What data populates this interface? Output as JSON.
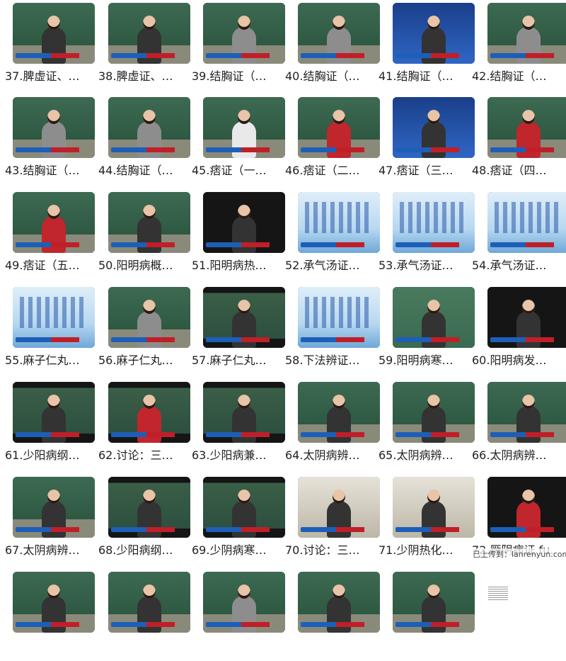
{
  "videos": [
    {
      "label": "37.脾虚证、…",
      "style": "board"
    },
    {
      "label": "38.脾虚证、…",
      "style": "board"
    },
    {
      "label": "39.结胸证（…",
      "style": "board grey"
    },
    {
      "label": "40.结胸证（…",
      "style": "board grey"
    },
    {
      "label": "41.结胸证（…",
      "style": "blue"
    },
    {
      "label": "42.结胸证（…",
      "style": "board grey"
    },
    {
      "label": "43.结胸证（…",
      "style": "board grey"
    },
    {
      "label": "44.结胸证（…",
      "style": "board grey"
    },
    {
      "label": "45.痞证（一…",
      "style": "board white"
    },
    {
      "label": "46.痞证（二…",
      "style": "board red"
    },
    {
      "label": "47.痞证（三…",
      "style": "blue"
    },
    {
      "label": "48.痞证（四…",
      "style": "board red"
    },
    {
      "label": "49.痞证（五…",
      "style": "board red"
    },
    {
      "label": "50.阳明病概…",
      "style": "board"
    },
    {
      "label": "51.阳明病热…",
      "style": "dark"
    },
    {
      "label": "52.承气汤证…",
      "style": "slide"
    },
    {
      "label": "53.承气汤证…",
      "style": "slide"
    },
    {
      "label": "54.承气汤证…",
      "style": "slide"
    },
    {
      "label": "55.麻子仁丸…",
      "style": "slide"
    },
    {
      "label": "56.麻子仁丸…",
      "style": "board grey"
    },
    {
      "label": "57.麻子仁丸…",
      "style": "darkboard"
    },
    {
      "label": "58.下法辨证…",
      "style": "slide"
    },
    {
      "label": "59.阳明病寒…",
      "style": "board2"
    },
    {
      "label": "60.阳明病发…",
      "style": "dark"
    },
    {
      "label": "61.少阳病纲…",
      "style": "darkboard"
    },
    {
      "label": "62.讨论：三…",
      "style": "darkboard red"
    },
    {
      "label": "63.少阳病兼…",
      "style": "darkboard"
    },
    {
      "label": "64.太阴病辨…",
      "style": "board"
    },
    {
      "label": "65.太阴病辨…",
      "style": "board"
    },
    {
      "label": "66.太阴病辨…",
      "style": "board"
    },
    {
      "label": "67.太阴病辨…",
      "style": "board"
    },
    {
      "label": "68.少阳病纲…",
      "style": "darkboard"
    },
    {
      "label": "69.少阴病寒…",
      "style": "darkboard"
    },
    {
      "label": "70.讨论：三…",
      "style": "room"
    },
    {
      "label": "71.少阴热化…",
      "style": "room"
    },
    {
      "label": "72.厥阴病证 fu…",
      "style": "dark red"
    },
    {
      "label": "",
      "style": "board"
    },
    {
      "label": "",
      "style": "board"
    },
    {
      "label": "",
      "style": "board grey"
    },
    {
      "label": "",
      "style": "board"
    },
    {
      "label": "",
      "style": "board"
    }
  ],
  "watermark": "已上传到：lanrenyun.com"
}
